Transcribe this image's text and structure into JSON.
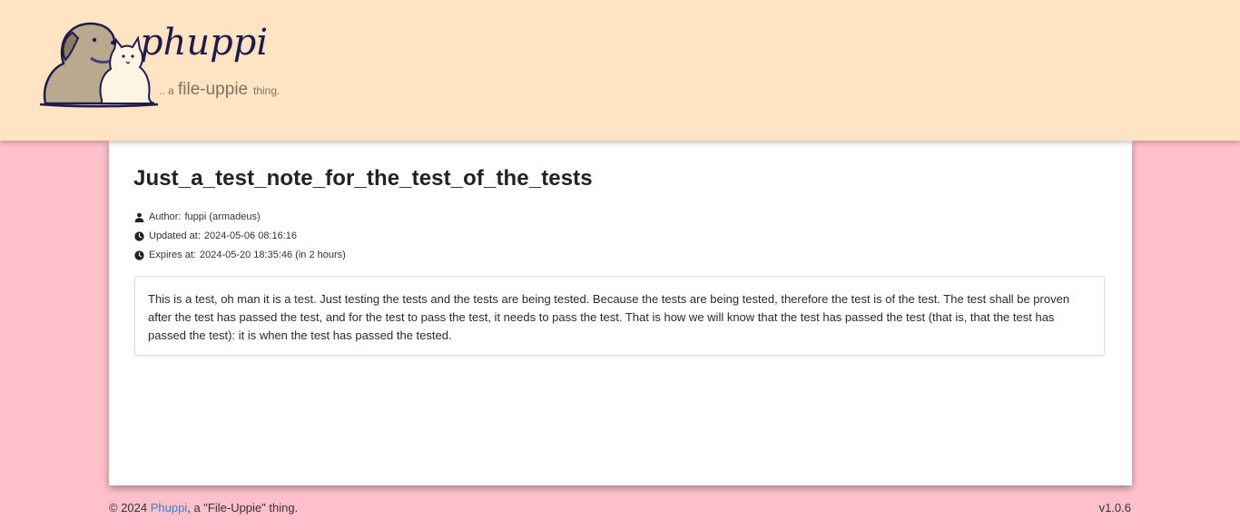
{
  "header": {
    "logo_text": "phuppi",
    "logo_tagline_prefix": ".. a",
    "logo_tagline_brand": "file-uppie",
    "logo_tagline_suffix": "thing."
  },
  "note": {
    "title": "Just_a_test_note_for_the_test_of_the_tests",
    "author_label": "Author:",
    "author": "fuppi (armadeus)",
    "updated_label": "Updated at:",
    "updated": "2024-05-06 08:16:16",
    "expires_label": "Expires at:",
    "expires": "2024-05-20 18:35:46 (in 2 hours)",
    "body": "This is a test, oh man it is a test. Just testing the tests and the tests are being tested. Because the tests are being tested, therefore the test is of the test. The test shall be proven after the test has passed the test, and for the test to pass the test, it needs to pass the test. That is how we will know that the test has passed the test (that is, that the test has passed the test): it is when the test has passed the tested."
  },
  "footer": {
    "copyright": "© 2024",
    "link_text": "Phuppi",
    "suffix": ", a \"File-Uppie\" thing.",
    "version": "v1.0.6"
  },
  "icons": {
    "author": "user-icon",
    "updated": "clock-icon",
    "expires": "clock-icon"
  },
  "colors": {
    "page_background": "#ffc0cb",
    "header_background": "#ffe4c4",
    "card_background": "#ffffff",
    "link": "#3b82c4"
  }
}
